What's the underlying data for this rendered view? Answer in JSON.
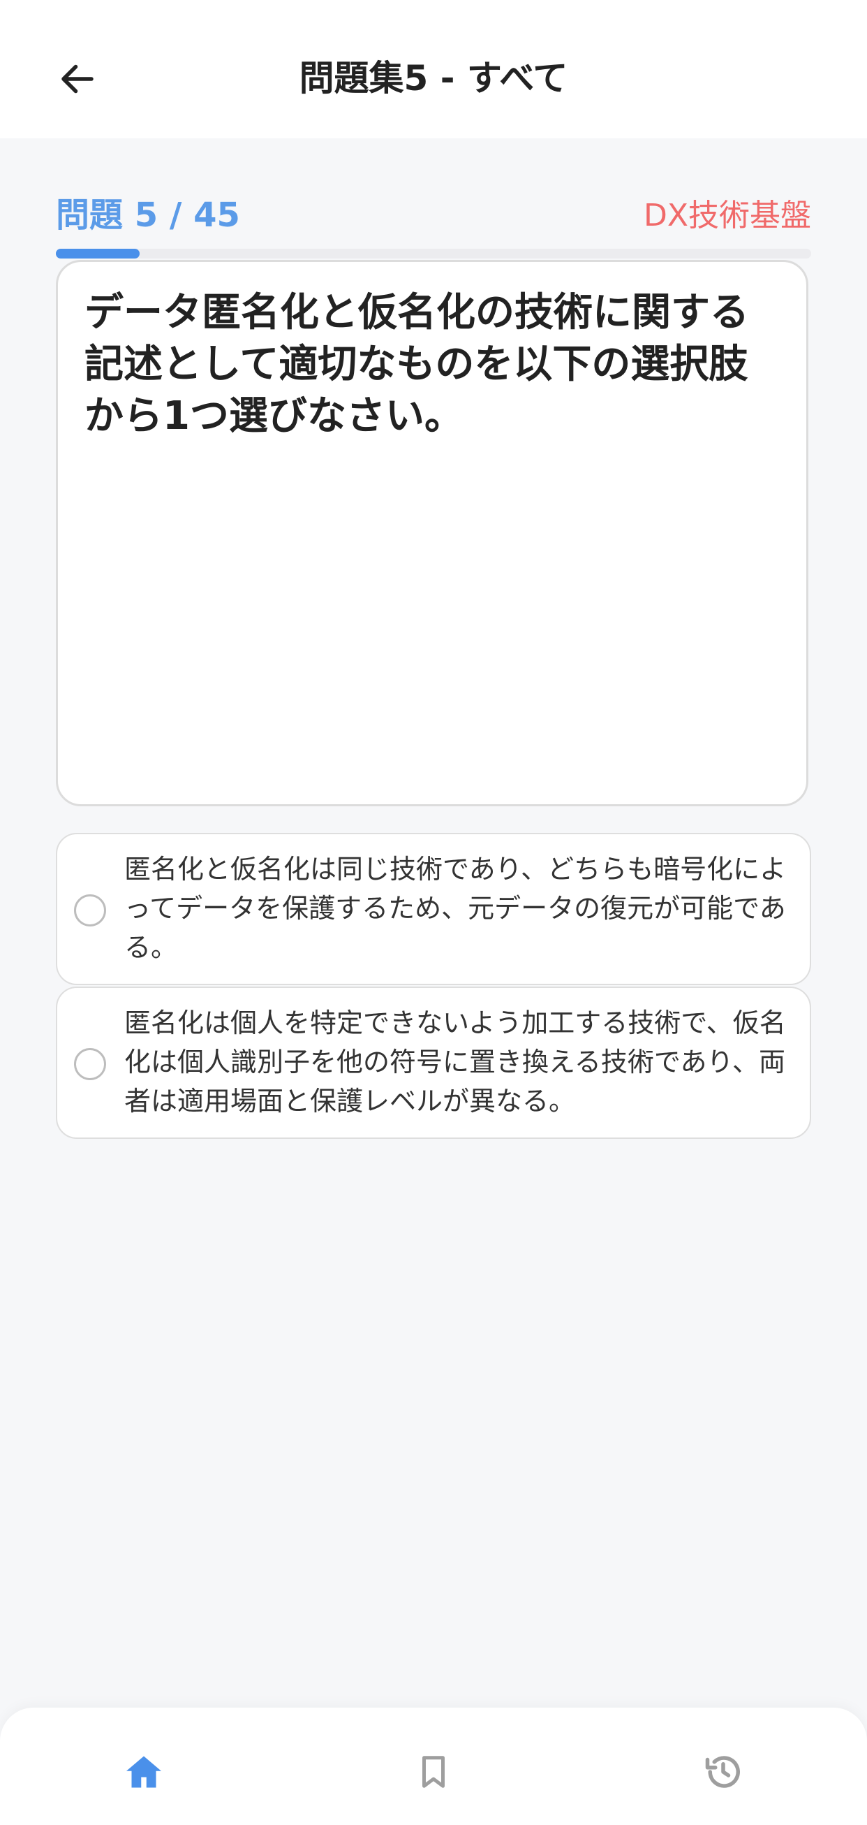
{
  "header": {
    "title": "問題集5 - すべて"
  },
  "quiz": {
    "progress_label": "問題 5 / 45",
    "category": "DX技術基盤",
    "progress_fraction": 0.111,
    "question": "データ匿名化と仮名化の技術に関する記述として適切なものを以下の選択肢から1つ選びなさい。",
    "options": [
      {
        "text": "匿名化と仮名化は同じ技術であり、どちらも暗号化によってデータを保護するため、元データの復元が可能である。",
        "selected": false
      },
      {
        "text": "匿名化は個人を特定できないよう加工する技術で、仮名化は個人識別子を他の符号に置き換える技術であり、両者は適用場面と保護レベルが異なる。",
        "selected": false
      }
    ]
  },
  "nav": {
    "items": [
      {
        "icon": "home-icon",
        "active": true
      },
      {
        "icon": "bookmark-icon",
        "active": false
      },
      {
        "icon": "history-icon",
        "active": false
      }
    ]
  },
  "colors": {
    "accent": "#4a90ea",
    "category": "#f06a6a",
    "inactive_icon": "#9e9e9e"
  }
}
